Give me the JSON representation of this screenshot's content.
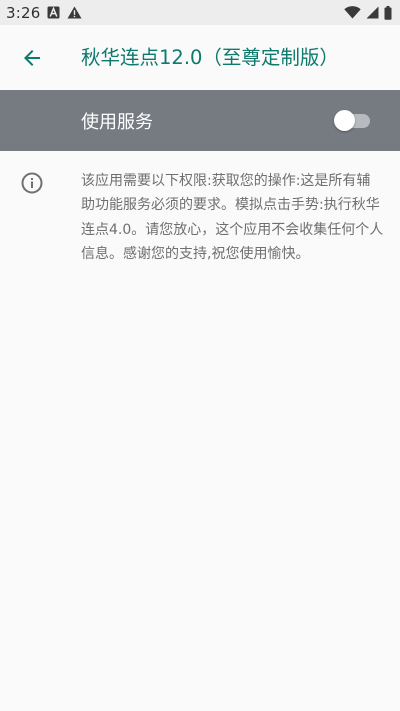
{
  "status_bar": {
    "time": "3:26",
    "left_icons": [
      "a-badge-icon",
      "warning-icon"
    ],
    "right_icons": [
      "wifi-icon",
      "cellular-icon",
      "battery-icon"
    ]
  },
  "app_bar": {
    "back_icon": "arrow-back-icon",
    "title": "秋华连点12.0（至尊定制版）"
  },
  "service": {
    "label": "使用服务",
    "enabled": false
  },
  "description": {
    "icon": "info-icon",
    "text": "该应用需要以下权限:获取您的操作:这是所有辅助功能服务必须的要求。模拟点击手势:执行秋华连点4.0。请您放心，这个应用不会收集任何个人信息。感谢您的支持,祝您使用愉快。"
  },
  "colors": {
    "accent": "#0d7a6d",
    "switch_bar_bg": "#767b82",
    "background": "#fafafa"
  }
}
